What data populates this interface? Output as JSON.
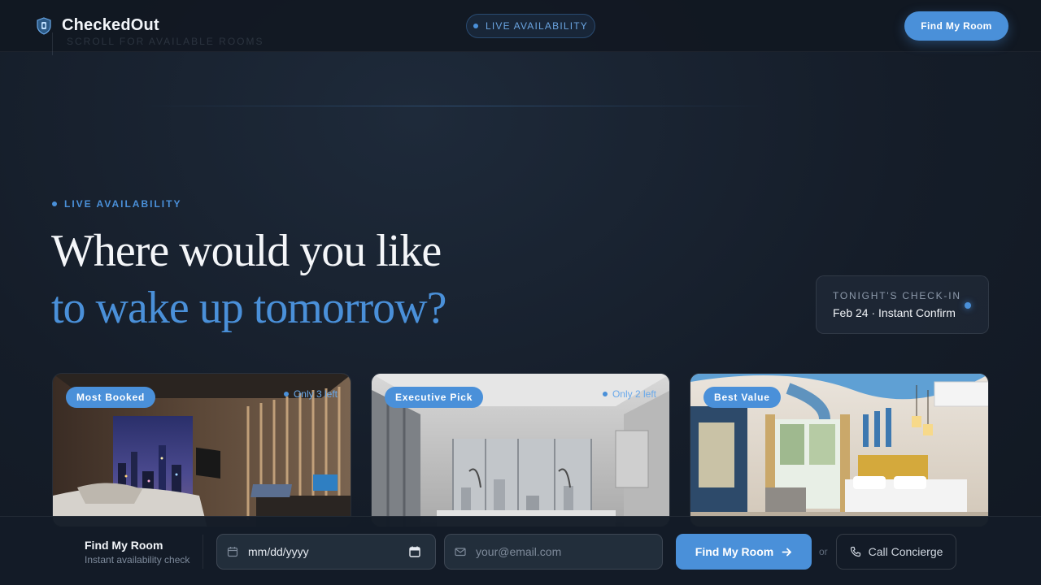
{
  "header": {
    "brand": "CheckedOut",
    "ghost_text": "SCROLL FOR AVAILABLE ROOMS",
    "live_pill": "LIVE AVAILABILITY",
    "cta": "Find My Room"
  },
  "hero": {
    "eyebrow": "LIVE AVAILABILITY",
    "headline_line1": "Where would you like",
    "headline_line2": "to wake up tomorrow?"
  },
  "checkin": {
    "label": "TONIGHT'S CHECK-IN",
    "value": "Feb 24 · Instant Confirm"
  },
  "rooms": [
    {
      "badge": "Most Booked",
      "availability": "Only 3 left"
    },
    {
      "badge": "Executive Pick",
      "availability": "Only 2 left"
    },
    {
      "badge": "Best Value",
      "availability": ""
    }
  ],
  "booking_bar": {
    "title": "Find My Room",
    "subtitle": "Instant availability check",
    "date_value": "mm/dd/yyyy",
    "email_placeholder": "your@email.com",
    "submit_label": "Find My Room",
    "or_text": "or",
    "call_label": "Call Concierge"
  },
  "colors": {
    "accent": "#4a90d9",
    "background": "#151d29",
    "text": "#f1f4f8"
  },
  "icons": {
    "logo": "shield-key-icon",
    "date": "calendar-icon",
    "email": "mail-icon",
    "submit": "arrow-right-icon",
    "call": "phone-icon"
  }
}
